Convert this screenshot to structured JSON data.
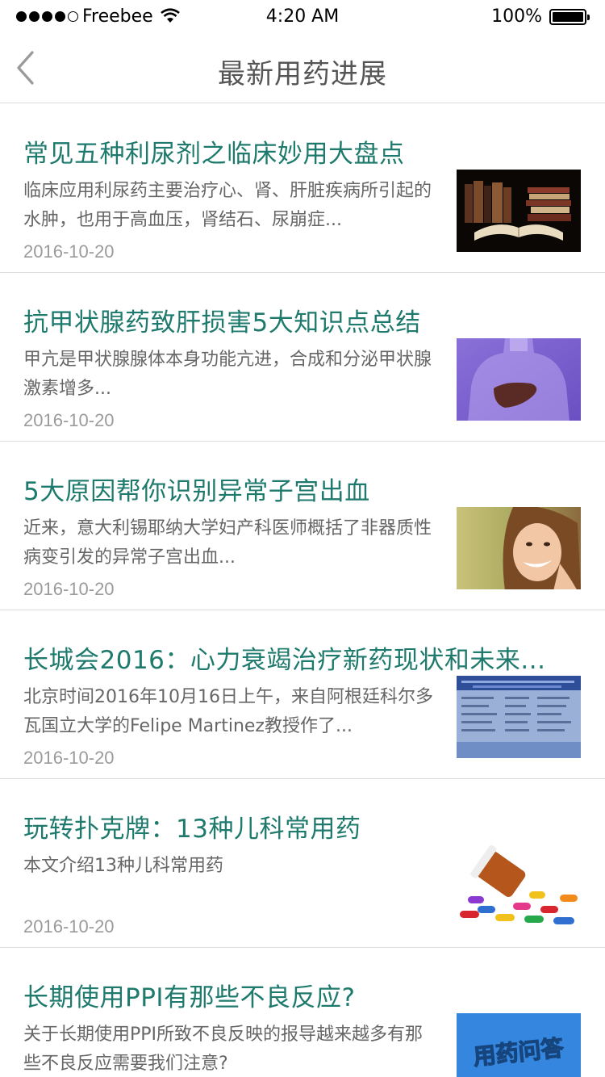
{
  "status_bar": {
    "carrier": "Freebee",
    "time": "4:20 AM",
    "battery_percent": "100%"
  },
  "nav": {
    "title": "最新用药进展",
    "back_icon": "chevron-left-icon"
  },
  "articles": [
    {
      "title": "常见五种利尿剂之临床妙用大盘点",
      "summary": "临床应用利尿药主要治疗心、肾、肝脏疾病所引起的水肿，也用于高血压，肾结石、尿崩症...",
      "date": "2016-10-20",
      "thumbnail": "books-image"
    },
    {
      "title": "抗甲状腺药致肝损害5大知识点总结",
      "summary": "甲亢是甲状腺腺体本身功能亢进，合成和分泌甲状腺激素增多...",
      "date": "2016-10-20",
      "thumbnail": "anatomy-liver-image"
    },
    {
      "title": "5大原因帮你识别异常子宫出血",
      "summary": "近来，意大利锡耶纳大学妇产科医师概括了非器质性病变引发的异常子宫出血...",
      "date": "2016-10-20",
      "thumbnail": "smiling-woman-image"
    },
    {
      "title": "长城会2016：心力衰竭治疗新药现状和未来...",
      "summary": "北京时间2016年10月16日上午，来自阿根廷科尔多瓦国立大学的Felipe Martinez教授作了...",
      "date": "2016-10-20",
      "thumbnail": "presentation-slide-image"
    },
    {
      "title": "玩转扑克牌：13种儿科常用药",
      "summary": "本文介绍13种儿科常用药",
      "date": "2016-10-20",
      "thumbnail": "pills-bottle-image"
    },
    {
      "title": "长期使用PPI有那些不良反应?",
      "summary": "关于长期使用PPI所致不良反映的报导越来越多有那些不良反应需要我们注意?",
      "date": "",
      "thumbnail": "qa-sign-image",
      "thumbnail_text": "用药问答"
    }
  ],
  "colors": {
    "title": "#1e7a6c",
    "summary": "#666666",
    "date": "#9b9b9b",
    "divider": "#dcdcdc"
  }
}
